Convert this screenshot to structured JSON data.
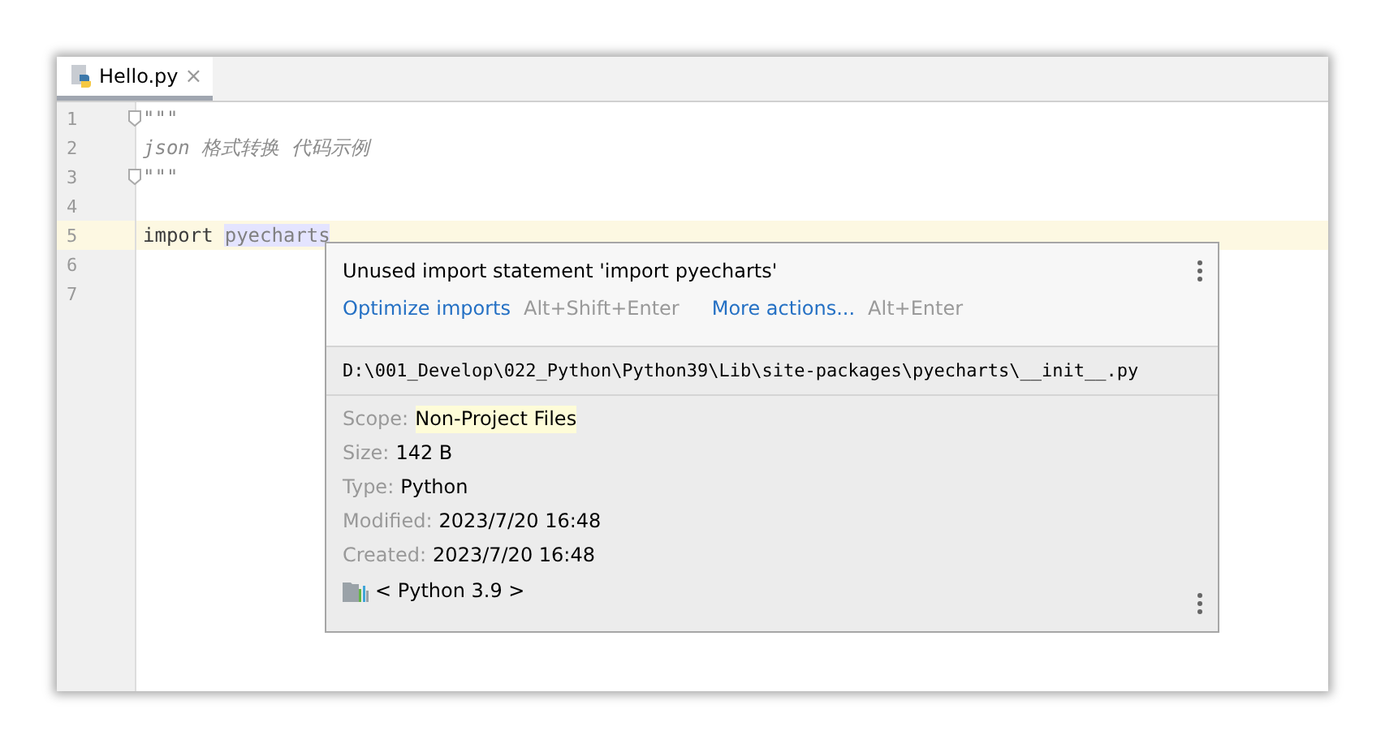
{
  "tabs": [
    {
      "label": "Hello.py",
      "close": "×",
      "selected": true
    }
  ],
  "lines": [
    {
      "number": "1",
      "current": false,
      "fold": true,
      "tokens": [
        {
          "text": "\"\"\"",
          "kind": "comment"
        }
      ]
    },
    {
      "number": "2",
      "current": false,
      "fold": false,
      "tokens": [
        {
          "text": "json 格式转换 代码示例",
          "kind": "comment"
        }
      ]
    },
    {
      "number": "3",
      "current": false,
      "fold": true,
      "tokens": [
        {
          "text": "\"\"\"",
          "kind": "comment"
        }
      ]
    },
    {
      "number": "4",
      "current": false,
      "fold": false
    },
    {
      "number": "5",
      "current": true,
      "fold": false,
      "tokens": [
        {
          "text": "import",
          "kind": "keyword"
        },
        {
          "text": "pyecharts",
          "kind": "unused"
        }
      ]
    },
    {
      "number": "6",
      "current": false,
      "fold": false
    },
    {
      "number": "7",
      "current": false,
      "fold": false
    }
  ],
  "popup": {
    "message": "Unused import statement 'import pyecharts'",
    "actions": [
      {
        "label": "Optimize imports",
        "shortcut": "Alt+Shift+Enter"
      },
      {
        "label": "More actions...",
        "shortcut": "Alt+Enter"
      }
    ],
    "path": "D:\\001_Develop\\022_Python\\Python39\\Lib\\site-packages\\pyecharts\\__init__.py",
    "properties": [
      {
        "label": "Scope:",
        "value": "Non-Project Files",
        "highlighted": true
      },
      {
        "label": "Size:",
        "value": "142 B",
        "highlighted": false
      },
      {
        "label": "Type:",
        "value": "Python",
        "highlighted": false
      },
      {
        "label": "Modified:",
        "value": "2023/7/20 16:48",
        "highlighted": false
      },
      {
        "label": "Created:",
        "value": "2023/7/20 16:48",
        "highlighted": false
      }
    ],
    "sdk": "< Python 3.9 >"
  }
}
